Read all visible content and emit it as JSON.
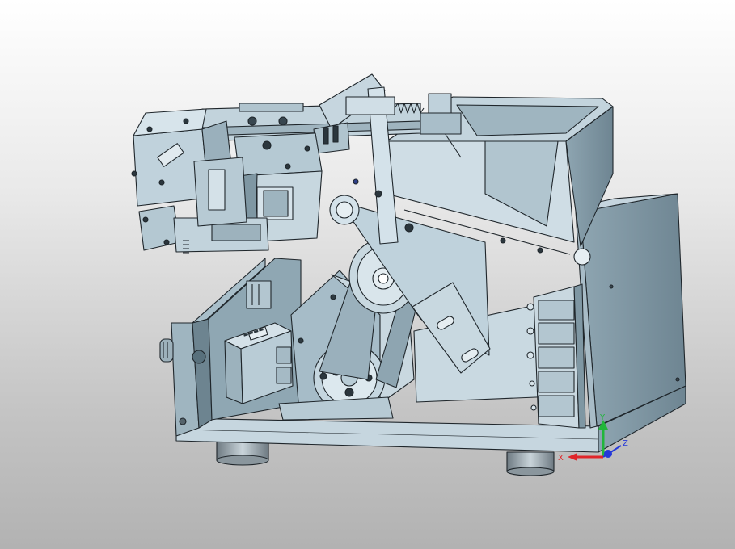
{
  "viewport": {
    "background_top": "#ffffff",
    "background_bottom": "#b2b2b2",
    "model_fill": "#b9cdd8",
    "model_fill_light": "#d2e0e8",
    "model_fill_dark": "#7f96a3",
    "edge_color": "#1f262b"
  },
  "label_plate": {
    "text": "▬▬▬▬"
  },
  "triad": {
    "x_label": "X",
    "y_label": "Y",
    "z_label": "Z",
    "x_color": "#e0262a",
    "y_color": "#21b63b",
    "z_color": "#2438d8",
    "icon": "view-triad-icon"
  }
}
